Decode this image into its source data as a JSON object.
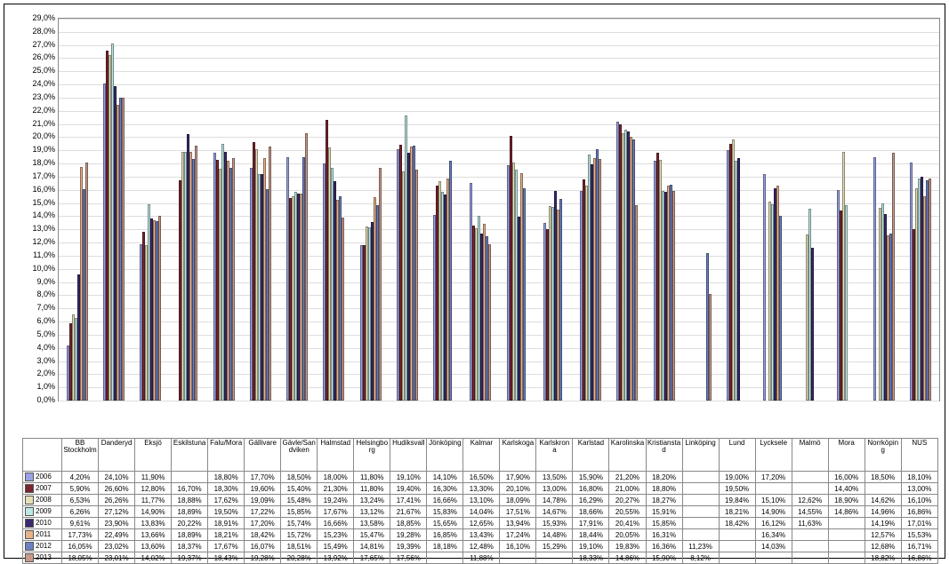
{
  "chart_data": {
    "type": "bar",
    "ylabel": "",
    "xlabel": "",
    "title": "",
    "ylim": [
      0,
      29
    ],
    "y_format": "percent_1dp_comma",
    "categories": [
      "BB Stockholm",
      "Danderyd",
      "Eksjö",
      "Eskilstuna",
      "Falu/Mora",
      "Gällivare",
      "Gävle/Sandviken",
      "Halmstad",
      "Helsingborg",
      "Hudiksvall",
      "Jönköping",
      "Kalmar",
      "Karlskoga",
      "Karlskrona",
      "Karlstad",
      "Karolinska",
      "Kristianstad",
      "Linköping",
      "Lund",
      "Lycksele",
      "Malmö",
      "Mora",
      "Norrköping",
      "NUS"
    ],
    "series": [
      {
        "name": "2006",
        "color": "#9aa2e3",
        "values": [
          4.2,
          24.1,
          11.9,
          null,
          18.8,
          17.7,
          18.5,
          18.0,
          11.8,
          19.1,
          14.1,
          16.5,
          17.9,
          13.5,
          15.9,
          21.2,
          18.2,
          null,
          19.0,
          17.2,
          null,
          16.0,
          18.5,
          18.1
        ]
      },
      {
        "name": "2007",
        "color": "#7a2630",
        "values": [
          5.9,
          26.6,
          12.8,
          16.7,
          18.3,
          19.6,
          15.4,
          21.3,
          11.8,
          19.4,
          16.3,
          13.3,
          20.1,
          13.0,
          16.8,
          21.0,
          18.8,
          null,
          19.5,
          null,
          null,
          14.4,
          null,
          13.0
        ]
      },
      {
        "name": "2008",
        "color": "#e6e0b8",
        "values": [
          6.53,
          26.26,
          11.77,
          18.88,
          17.62,
          19.09,
          15.48,
          19.24,
          13.24,
          17.41,
          16.66,
          13.1,
          18.09,
          14.78,
          16.29,
          20.27,
          18.27,
          null,
          19.84,
          15.1,
          12.62,
          18.9,
          14.62,
          16.1
        ]
      },
      {
        "name": "2009",
        "color": "#bde8e4",
        "values": [
          6.26,
          27.12,
          14.9,
          18.89,
          19.5,
          17.22,
          15.85,
          17.67,
          13.12,
          21.67,
          15.83,
          14.04,
          17.51,
          14.67,
          18.66,
          20.55,
          15.91,
          null,
          18.21,
          14.9,
          14.55,
          14.86,
          14.96,
          16.86
        ]
      },
      {
        "name": "2010",
        "color": "#3a2a6d",
        "values": [
          9.61,
          23.9,
          13.83,
          20.22,
          18.91,
          17.2,
          15.74,
          16.66,
          13.58,
          18.85,
          15.65,
          12.65,
          13.94,
          15.93,
          17.91,
          20.41,
          15.85,
          null,
          18.42,
          16.12,
          11.63,
          null,
          14.19,
          17.01
        ]
      },
      {
        "name": "2011",
        "color": "#e7b18a",
        "values": [
          17.73,
          22.49,
          13.66,
          18.89,
          18.21,
          18.42,
          15.72,
          15.23,
          15.47,
          19.28,
          16.85,
          13.43,
          17.24,
          14.48,
          18.44,
          20.05,
          16.31,
          null,
          null,
          16.34,
          null,
          null,
          12.57,
          15.53
        ]
      },
      {
        "name": "2012",
        "color": "#6c80c2",
        "values": [
          16.05,
          23.02,
          13.6,
          18.37,
          17.67,
          16.07,
          18.51,
          15.49,
          14.81,
          19.39,
          18.18,
          12.48,
          16.1,
          15.29,
          19.1,
          19.83,
          16.36,
          11.23,
          null,
          14.03,
          null,
          null,
          12.68,
          16.71
        ]
      },
      {
        "name": "2013",
        "color": "#c89a8b",
        "values": [
          18.05,
          23.01,
          14.02,
          19.37,
          18.43,
          19.28,
          20.28,
          13.92,
          17.65,
          17.56,
          null,
          11.88,
          null,
          null,
          18.33,
          14.86,
          15.9,
          8.12,
          null,
          null,
          null,
          null,
          18.82,
          16.86
        ]
      }
    ]
  }
}
